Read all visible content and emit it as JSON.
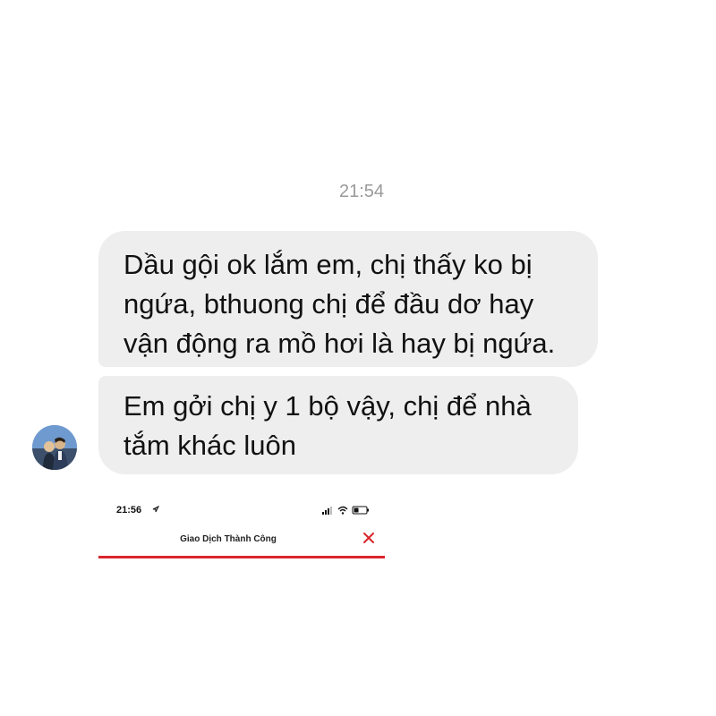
{
  "chat": {
    "timestamp": "21:54",
    "messages": [
      {
        "lines": [
          "Dầu gội ok lắm em, chị thấy ko bị",
          "ngứa, bthuong chị để đầu dơ hay",
          "vận động ra mồ hơi là hay bị ngứa."
        ]
      },
      {
        "lines": [
          "Em gởi chị y 1 bộ vậy, chị để nhà",
          "tắm khác luôn"
        ]
      }
    ],
    "bubble_color": "#eeeeef"
  },
  "embedded_screenshot": {
    "status_time": "21:56",
    "status_icons": [
      "location-arrow-icon",
      "signal-icon",
      "wifi-icon",
      "battery-icon"
    ],
    "title": "Giao Dịch Thành Công",
    "close_icon": "close-icon",
    "accent_color": "#d9262b"
  }
}
